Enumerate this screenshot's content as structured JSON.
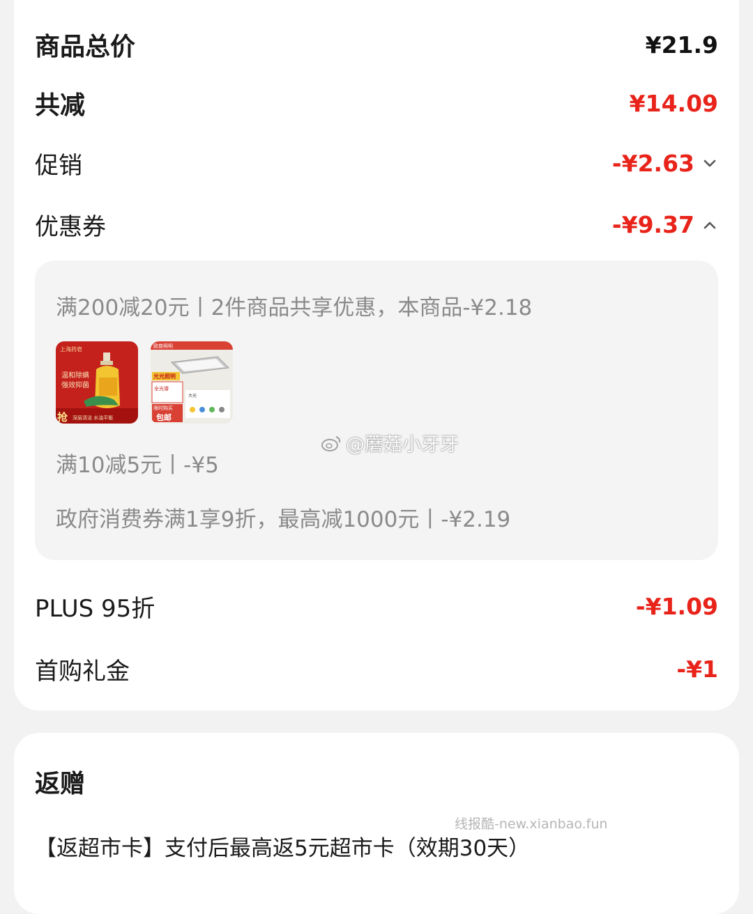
{
  "summary": {
    "total_label": "商品总价",
    "total_value": "¥21.9",
    "reduce_label": "共减",
    "reduce_value": "¥14.09",
    "promo_label": "促销",
    "promo_value": "-¥2.63",
    "promo_icon": "chevron-down-icon",
    "coupon_label": "优惠券",
    "coupon_value": "-¥9.37",
    "coupon_icon": "chevron-up-icon",
    "plus_label": "PLUS 95折",
    "plus_value": "-¥1.09",
    "first_label": "首购礼金",
    "first_value": "-¥1"
  },
  "coupons": {
    "line1": "满200减20元丨2件商品共享优惠，本商品-¥2.18",
    "line2": "满10减5元丨-¥5",
    "line3": "政府消费券满1享9折，最高减1000元丨-¥2.19",
    "thumbs": [
      {
        "name": "hand-soap-product",
        "texts": [
          "上海药皂",
          "温和除螨",
          "强效抑菌",
          "抢",
          "深层清洁 水油平衡"
        ]
      },
      {
        "name": "ceiling-light-product",
        "texts": [
          "欧普照明",
          "光光照明",
          "全光谱",
          "限时购买",
          "包邮",
          "大光"
        ]
      }
    ]
  },
  "watermark": "@蘑菇小牙牙",
  "site_watermark": "线报酷-new.xianbao.fun",
  "gift": {
    "title": "返赠",
    "text": "【返超市卡】支付后最高返5元超市卡（效期30天）"
  },
  "colors": {
    "accent_red": "#e8231a",
    "card_bg": "#ffffff",
    "page_bg": "#f2f2f2",
    "coupon_bg": "#f4f4f4",
    "muted_text": "#8a8a8a"
  }
}
